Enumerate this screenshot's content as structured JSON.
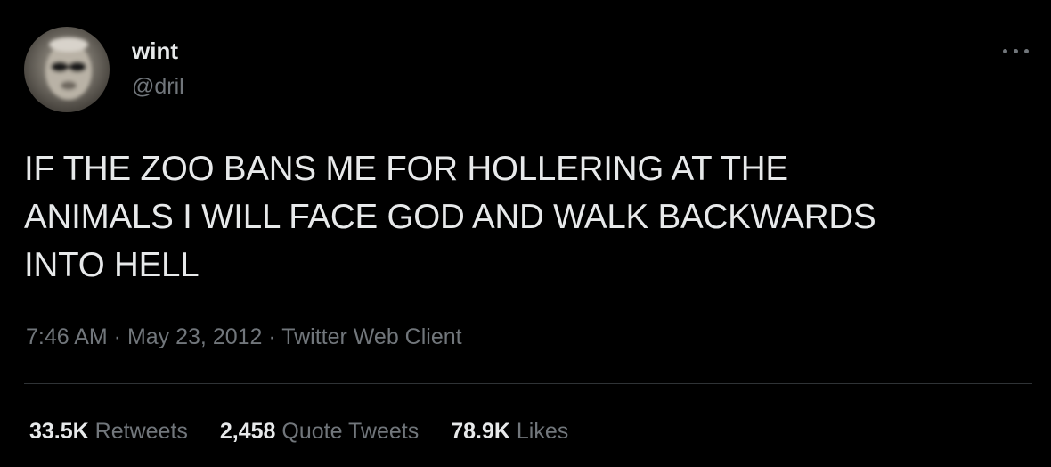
{
  "user": {
    "display_name": "wint",
    "handle": "@dril",
    "avatar_icon": "profile-photo"
  },
  "more_icon": "more-horizontal-icon",
  "tweet": {
    "text": "IF THE ZOO BANS ME FOR HOLLERING AT THE\nANIMALS I WILL FACE GOD AND WALK BACKWARDS\nINTO HELL",
    "time": "7:46 AM",
    "sep1": " · ",
    "date": "May 23, 2012",
    "sep2": " · ",
    "source": "Twitter Web Client"
  },
  "stats": {
    "retweets_count": "33.5K",
    "retweets_label": "Retweets",
    "quotes_count": "2,458",
    "quotes_label": "Quote Tweets",
    "likes_count": "78.9K",
    "likes_label": "Likes"
  },
  "colors": {
    "background": "#000000",
    "text_primary": "#e7e9ea",
    "text_secondary": "#71767b",
    "divider": "#2f3336"
  }
}
